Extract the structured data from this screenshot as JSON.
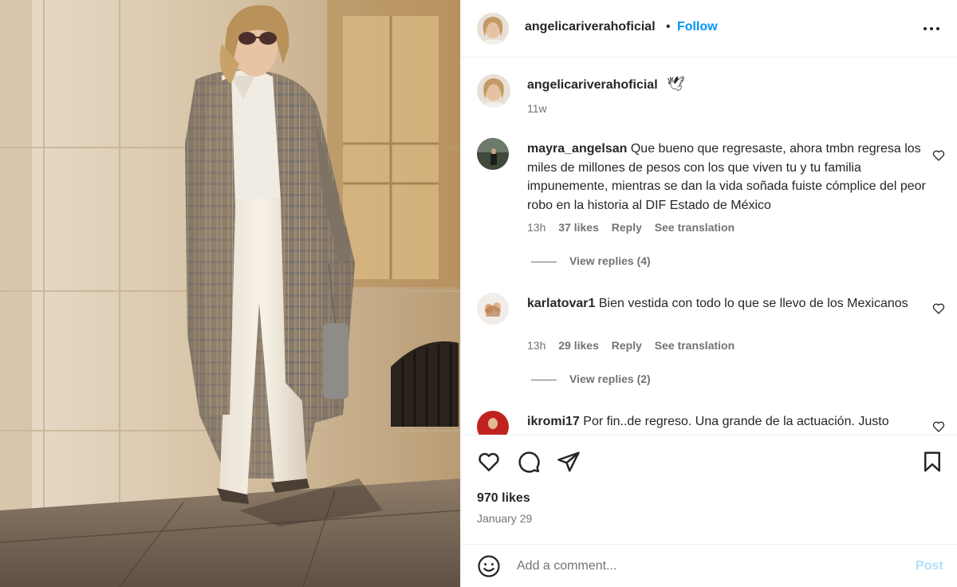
{
  "post": {
    "photo_icon": "photo-woman-plaid-coat",
    "header": {
      "username": "angelicariverahoficial",
      "separator": "•",
      "follow_label": "Follow",
      "more_icon": "more-horizontal-icon"
    },
    "caption": {
      "username": "angelicariverahoficial",
      "emoji": "🕊",
      "time": "11w"
    },
    "comments": [
      {
        "username": "mayra_angelsan",
        "text": "Que bueno que regresaste, ahora tmbn regresa los miles de millones de pesos con los que viven tu y tu familia impunemente, mientras se dan la vida soñada fuiste cómplice del peor robo en la historia al DIF Estado de México",
        "time": "13h",
        "likes": "37 likes",
        "reply_label": "Reply",
        "translate_label": "See translation",
        "view_replies": "View replies (4)"
      },
      {
        "username": "karlatovar1",
        "text": "Bien vestida con todo lo que se llevo de los Mexicanos",
        "time": "13h",
        "likes": "29 likes",
        "reply_label": "Reply",
        "translate_label": "See translation",
        "view_replies": "View replies (2)"
      },
      {
        "username": "ikromi17",
        "text": "Por fin..de regreso. Una grande de la actuación. Justo"
      }
    ],
    "actions": {
      "like_icon": "heart-icon",
      "comment_icon": "comment-icon",
      "share_icon": "paper-plane-icon",
      "save_icon": "bookmark-icon"
    },
    "likes": "970 likes",
    "date": "January 29",
    "add_comment": {
      "placeholder": "Add a comment...",
      "post_label": "Post",
      "emoji_icon": "smiley-icon"
    },
    "colors": {
      "accent": "#0095f6",
      "post_disabled": "#b2dffc",
      "secondary_text": "#737373",
      "divider": "#efefef"
    }
  }
}
